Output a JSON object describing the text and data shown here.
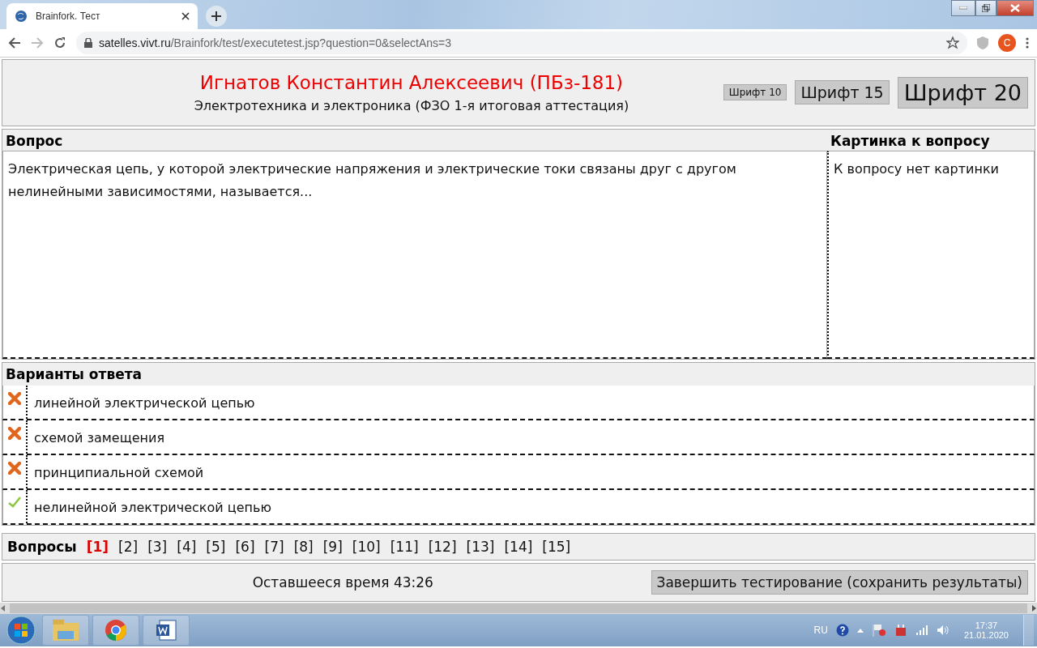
{
  "browser": {
    "tab_title": "Brainfork. Тест",
    "url_host": "satelles.vivt.ru",
    "url_path": "/Brainfork/test/executetest.jsp?question=0&selectAns=3",
    "profile_initial": "C"
  },
  "header": {
    "student": "Игнатов Константин Алексеевич (ПБз-181)",
    "course": "Электротехника и электроника (ФЗО 1-я итоговая аттестация)",
    "font_buttons": [
      {
        "label": "Шрифт 10"
      },
      {
        "label": "Шрифт 15"
      },
      {
        "label": "Шрифт 20"
      }
    ]
  },
  "question": {
    "heading": "Вопрос",
    "text": "Электрическая цепь, у которой электрические напряжения и электрические токи связаны друг с другом нелинейными зависимостями, называется...",
    "picture_heading": "Картинка к вопросу",
    "picture_text": "К вопросу нет картинки"
  },
  "answers": {
    "heading": "Варианты ответа",
    "items": [
      {
        "text": "линейной электрической цепью",
        "correct": false
      },
      {
        "text": "схемой замещения",
        "correct": false
      },
      {
        "text": "принципиальной схемой",
        "correct": false
      },
      {
        "text": "нелинейной электрической цепью",
        "correct": true
      }
    ]
  },
  "questions_nav": {
    "label": "Вопросы",
    "items": [
      {
        "label": "[1]",
        "selected": true
      },
      {
        "label": "[2]",
        "selected": false
      },
      {
        "label": "[3]",
        "selected": false
      },
      {
        "label": "[4]",
        "selected": false
      },
      {
        "label": "[5]",
        "selected": false
      },
      {
        "label": "[6]",
        "selected": false
      },
      {
        "label": "[7]",
        "selected": false
      },
      {
        "label": "[8]",
        "selected": false
      },
      {
        "label": "[9]",
        "selected": false
      },
      {
        "label": "[10]",
        "selected": false
      },
      {
        "label": "[11]",
        "selected": false
      },
      {
        "label": "[12]",
        "selected": false
      },
      {
        "label": "[13]",
        "selected": false
      },
      {
        "label": "[14]",
        "selected": false
      },
      {
        "label": "[15]",
        "selected": false
      }
    ]
  },
  "footer": {
    "time_left": "Оставшееся время 43:26",
    "finish_button": "Завершить тестирование (сохранить результаты)"
  },
  "taskbar": {
    "language": "RU",
    "time": "17:37",
    "date": "21.01.2020"
  }
}
